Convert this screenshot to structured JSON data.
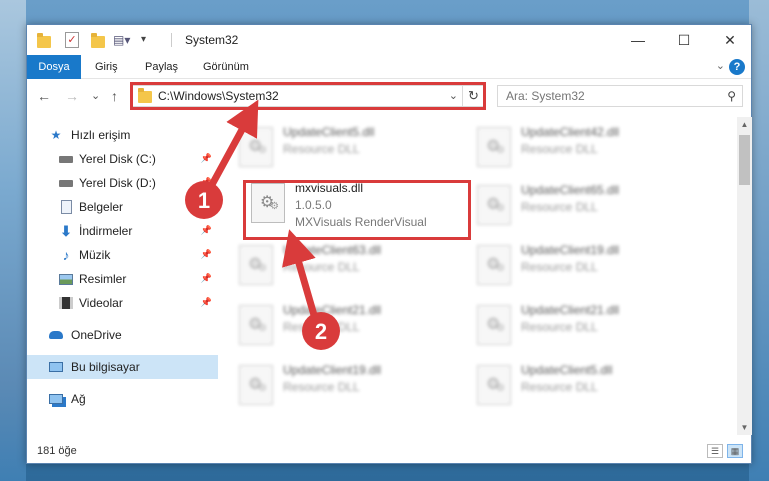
{
  "window": {
    "title": "System32",
    "minimize_glyph": "—",
    "maximize_glyph": "☐",
    "close_glyph": "✕"
  },
  "ribbon": {
    "file_tab": "Dosya",
    "tabs": [
      "Giriş",
      "Paylaş",
      "Görünüm"
    ],
    "collapse_glyph": "⌄",
    "help_glyph": "?"
  },
  "nav": {
    "back_glyph": "←",
    "forward_glyph": "→",
    "recent_glyph": "⌄",
    "up_glyph": "↑",
    "address": "C:\\Windows\\System32",
    "address_dropdown_glyph": "⌄",
    "refresh_glyph": "↻",
    "search_placeholder": "Ara: System32",
    "search_glyph": "⚲"
  },
  "sidebar": {
    "items": [
      {
        "label": "Hızlı erişim",
        "icon": "star-icon"
      },
      {
        "label": "Yerel Disk (C:)",
        "icon": "drive-icon",
        "pinned": true
      },
      {
        "label": "Yerel Disk (D:)",
        "icon": "drive-icon",
        "pinned": true
      },
      {
        "label": "Belgeler",
        "icon": "document-icon",
        "pinned": true
      },
      {
        "label": "İndirmeler",
        "icon": "download-icon",
        "pinned": true
      },
      {
        "label": "Müzik",
        "icon": "music-icon",
        "pinned": true
      },
      {
        "label": "Resimler",
        "icon": "pictures-icon",
        "pinned": true
      },
      {
        "label": "Videolar",
        "icon": "video-icon",
        "pinned": true
      },
      {
        "label": "OneDrive",
        "icon": "cloud-icon"
      },
      {
        "label": "Bu bilgisayar",
        "icon": "computer-icon",
        "selected": true
      },
      {
        "label": "Ağ",
        "icon": "network-icon"
      }
    ]
  },
  "files": {
    "highlighted": {
      "name": "mxvisuals.dll",
      "version": "1.0.5.0",
      "description": "MXVisuals RenderVisual"
    },
    "blurred": [
      {
        "name": "UpdateClient5.dll",
        "type": "Resource DLL"
      },
      {
        "name": "UpdateClient42.dll",
        "type": "Resource DLL"
      },
      {
        "name": "UpdateClient65.dll",
        "type": "Resource DLL"
      },
      {
        "name": "UpdateClient63.dll",
        "type": "Resource DLL"
      },
      {
        "name": "UpdateClient19.dll",
        "type": "Resource DLL"
      },
      {
        "name": "UpdateClient21.dll",
        "type": "Resource DLL"
      },
      {
        "name": "UpdateClient21.dll",
        "type": "Resource DLL"
      },
      {
        "name": "UpdateClient19.dll",
        "type": "Resource DLL"
      },
      {
        "name": "UpdateClient5.dll",
        "type": "Resource DLL"
      }
    ]
  },
  "status": {
    "count": "181 öğe",
    "details_view_glyph": "☰",
    "tiles_view_glyph": "▦"
  },
  "annotations": {
    "step1": "1",
    "step2": "2",
    "color": "#d93b3b"
  }
}
